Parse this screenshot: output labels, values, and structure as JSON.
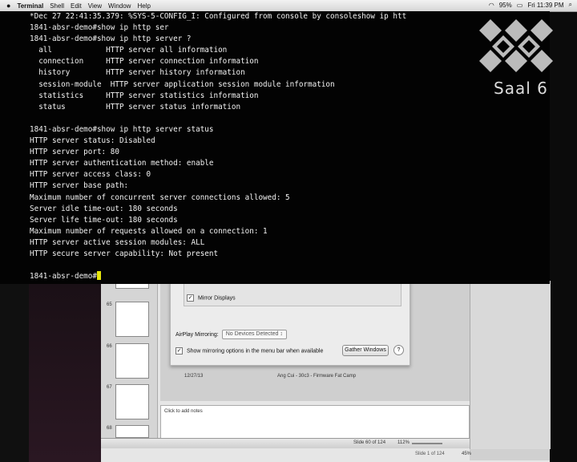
{
  "menubar": {
    "app_name": "Terminal",
    "menus": [
      "Shell",
      "Edit",
      "View",
      "Window",
      "Help"
    ],
    "battery": "95%",
    "clock": "Fri 11:39 PM"
  },
  "terminal": {
    "lines": [
      "*Dec 27 22:41:35.379: %SYS-5-CONFIG_I: Configured from console by consoleshow ip htt",
      "1841-absr-demo#show ip http ser",
      "1841-absr-demo#show ip http server ?",
      "  all            HTTP server all information",
      "  connection     HTTP server connection information",
      "  history        HTTP server history information",
      "  session-module  HTTP server application session module information",
      "  statistics     HTTP server statistics information",
      "  status         HTTP server status information",
      "",
      "1841-absr-demo#show ip http server status",
      "HTTP server status: Disabled",
      "HTTP server port: 80",
      "HTTP server authentication method: enable",
      "HTTP server access class: 0",
      "HTTP server base path:",
      "Maximum number of concurrent server connections allowed: 5",
      "Server idle time-out: 180 seconds",
      "Server life time-out: 180 seconds",
      "Maximum number of requests allowed on a connection: 1",
      "HTTP server active session modules: ALL",
      "HTTP secure server capability: Not present",
      ""
    ],
    "prompt": "1841-absr-demo#",
    "cursor_color": "#e6e60b"
  },
  "logo": {
    "label": "Saal 6"
  },
  "presentation": {
    "thumb_numbers": [
      "65",
      "66",
      "67",
      "68"
    ],
    "mirror_label": "Mirror Displays",
    "airplay_label": "AirPlay Mirroring:",
    "airplay_value": "No Devices Detected",
    "show_mirroring_label": "Show mirroring options in the menu bar when available",
    "gather_button": "Gather Windows",
    "help_button": "?",
    "footer_date": "12/27/13",
    "footer_title": "Ang Cui - 30c3 - Firmware Fat Camp",
    "notes_placeholder": "Click to add notes",
    "status_slide": "Slide 60 of 124",
    "status_zoom": "112%",
    "status2_slide": "Slide 1 of 124",
    "status2_zoom": "45%"
  }
}
